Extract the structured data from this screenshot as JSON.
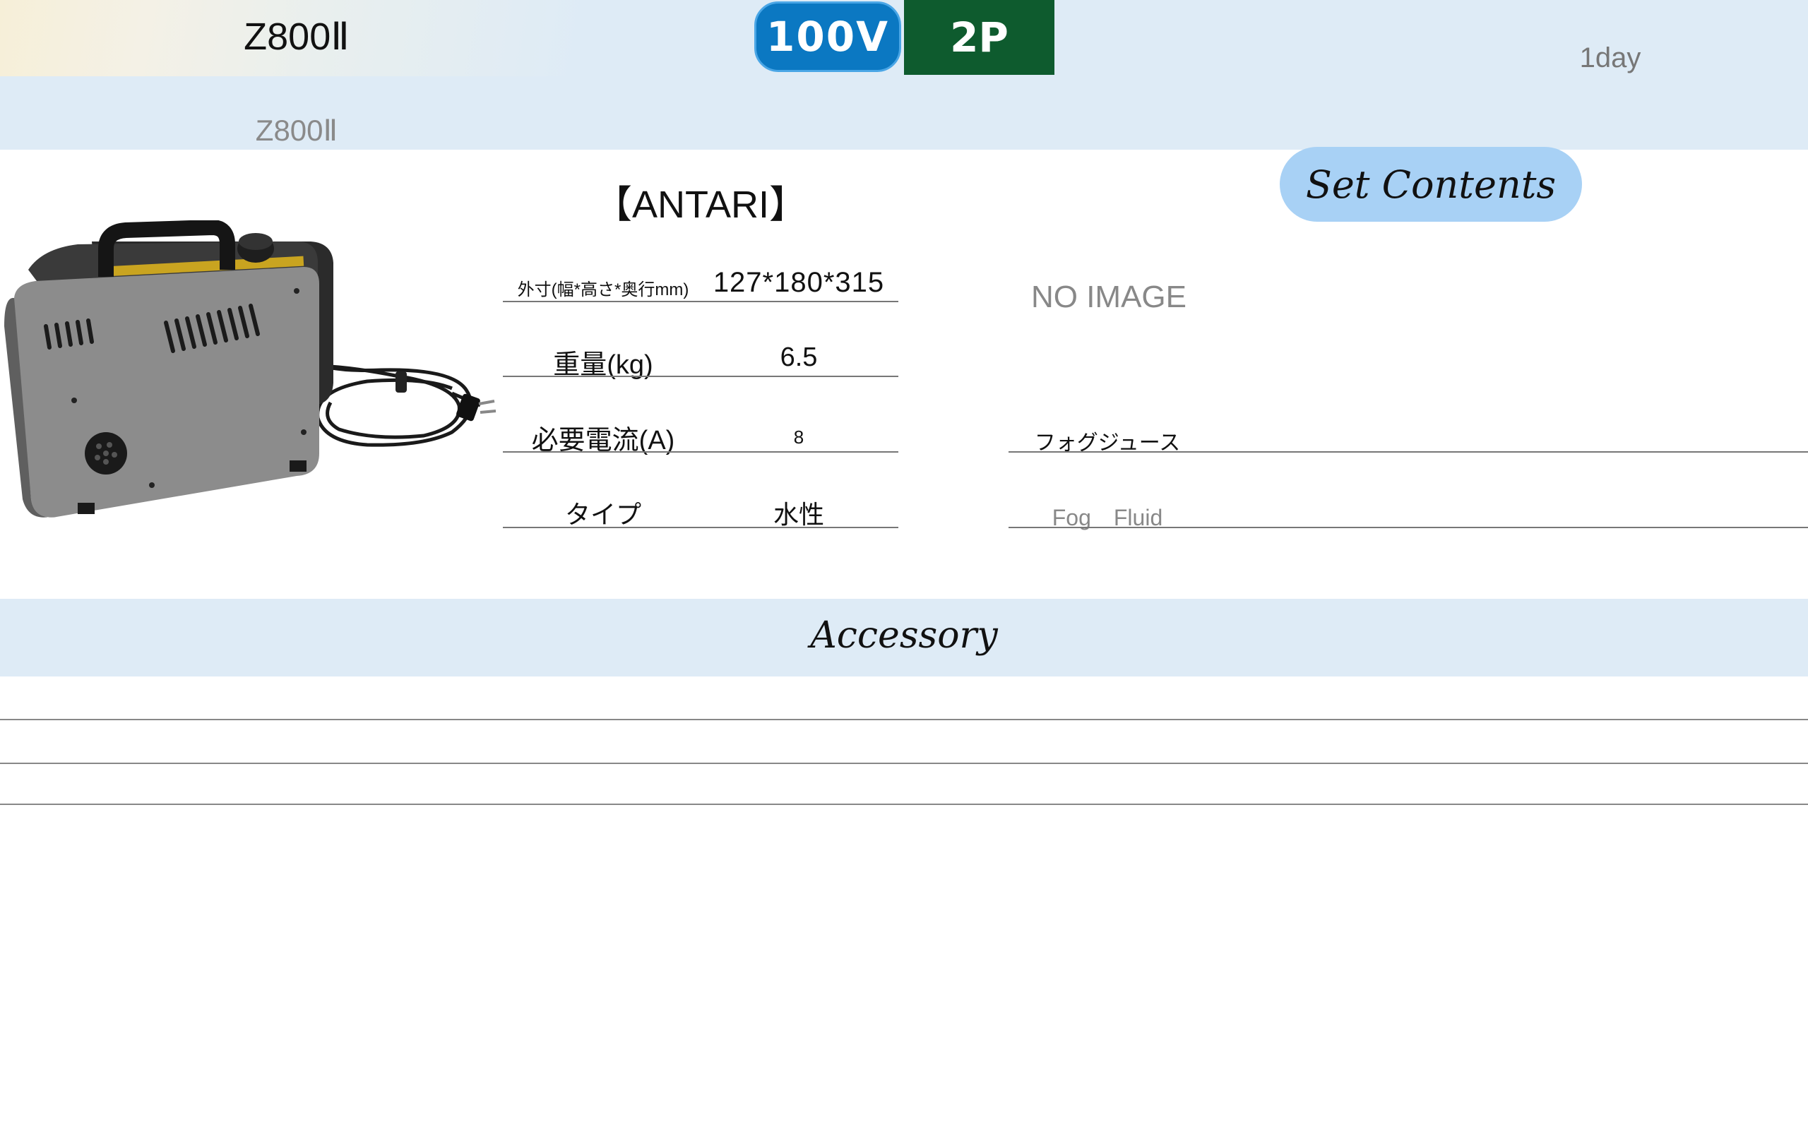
{
  "header": {
    "title": "Z800Ⅱ",
    "subtitle": "Z800Ⅱ",
    "voltage": "100V",
    "plug": "2P",
    "rental_period": "1day"
  },
  "specs": {
    "brand": "【ANTARI】",
    "rows": [
      {
        "label": "外寸(幅*高さ*奥行mm)",
        "value": "127*180*315"
      },
      {
        "label": "重量(kg)",
        "value": "6.5"
      },
      {
        "label": "必要電流(A)",
        "value": "8"
      },
      {
        "label": "タイプ",
        "value": "水性"
      }
    ]
  },
  "set_contents": {
    "title": "Set Contents",
    "no_image": "NO IMAGE",
    "items": [
      {
        "name": "フォグジュース",
        "subtitle": "Fog　Fluid"
      }
    ]
  },
  "accessory": {
    "title": "Accessory"
  },
  "colors": {
    "band": "#deebf6",
    "voltage_badge": "#0b78c2",
    "plug_badge": "#0e5b2e",
    "set_contents_pill": "#a8d1f5"
  }
}
